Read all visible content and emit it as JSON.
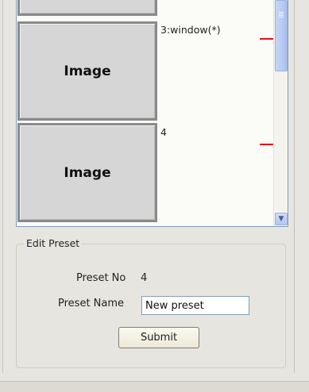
{
  "list": {
    "rows": [
      {
        "thumb_label": "",
        "caption": ""
      },
      {
        "thumb_label": "Image",
        "caption": "3:window(*)"
      },
      {
        "thumb_label": "Image",
        "caption": "4"
      }
    ]
  },
  "edit_preset": {
    "legend": "Edit Preset",
    "preset_no_label": "Preset No",
    "preset_no_value": "4",
    "preset_name_label": "Preset Name",
    "preset_name_value": "New preset",
    "submit_label": "Submit"
  },
  "colors": {
    "marker": "#e8101a",
    "scroll_thumb": "#b8cbf4"
  },
  "icons": {
    "scroll_down": "chevron-down-icon"
  }
}
